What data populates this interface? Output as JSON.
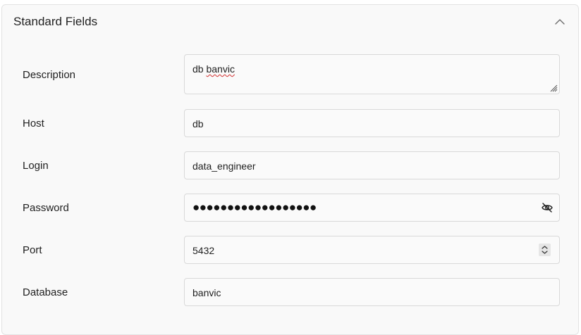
{
  "section": {
    "title": "Standard Fields",
    "collapse_icon": "chevron-up-icon"
  },
  "fields": {
    "description": {
      "label": "Description",
      "value_prefix": "db ",
      "value_misspelled": "banvic"
    },
    "host": {
      "label": "Host",
      "value": "db"
    },
    "login": {
      "label": "Login",
      "value": "data_engineer"
    },
    "password": {
      "label": "Password",
      "masked_value": "●●●●●●●●●●●●●●●●●●",
      "toggle_icon": "eye-off-icon"
    },
    "port": {
      "label": "Port",
      "value": "5432",
      "spinner_icon": "up-down-arrows-icon"
    },
    "database": {
      "label": "Database",
      "value": "banvic"
    }
  }
}
